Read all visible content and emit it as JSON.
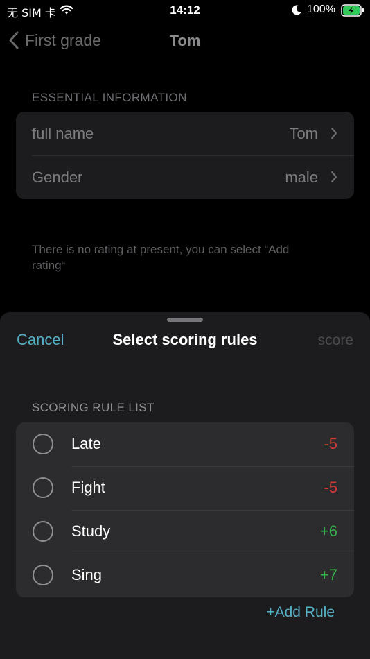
{
  "status_bar": {
    "carrier": "无 SIM 卡",
    "time": "14:12",
    "battery_percent": "100%",
    "icons": [
      "wifi-icon",
      "moon-icon",
      "battery-charging-icon"
    ]
  },
  "nav": {
    "back_label": "First grade",
    "title": "Tom"
  },
  "essential": {
    "header": "ESSENTIAL INFORMATION",
    "rows": [
      {
        "label": "full name",
        "value": "Tom"
      },
      {
        "label": "Gender",
        "value": "male"
      }
    ]
  },
  "hint": "There is no rating at present, you can select “Add rating“",
  "sheet": {
    "cancel_label": "Cancel",
    "title": "Select scoring rules",
    "score_label": "score",
    "section_header": "SCORING RULE LIST",
    "rules": [
      {
        "name": "Late",
        "points": "-5"
      },
      {
        "name": "Fight",
        "points": "-5"
      },
      {
        "name": "Study",
        "points": "+6"
      },
      {
        "name": "Sing",
        "points": "+7"
      }
    ],
    "add_rule_label": "+Add Rule"
  },
  "colors": {
    "accent": "#54b0c6",
    "negative": "#d23a36",
    "positive": "#35b34a"
  }
}
